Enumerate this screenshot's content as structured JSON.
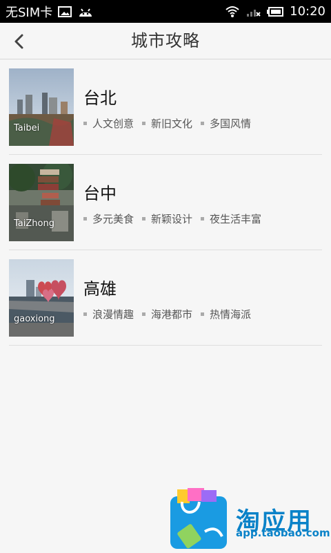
{
  "status_bar": {
    "left_text": "无SIM卡",
    "time": "10:20"
  },
  "header": {
    "title": "城市攻略"
  },
  "cities": [
    {
      "name": "台北",
      "label": "Taibei",
      "tags": [
        "人文创意",
        "新旧文化",
        "多国风情"
      ]
    },
    {
      "name": "台中",
      "label": "TaiZhong",
      "tags": [
        "多元美食",
        "新颖设计",
        "夜生活丰富"
      ]
    },
    {
      "name": "高雄",
      "label": "gaoxiong",
      "tags": [
        "浪漫情趣",
        "海港都市",
        "热情海派"
      ]
    }
  ],
  "footer_badge": {
    "title": "淘应用",
    "url": "app.taobao.com"
  },
  "colors": {
    "status_bar": "#000000",
    "background": "#f6f6f6",
    "brand_blue": "#0a82c8"
  }
}
